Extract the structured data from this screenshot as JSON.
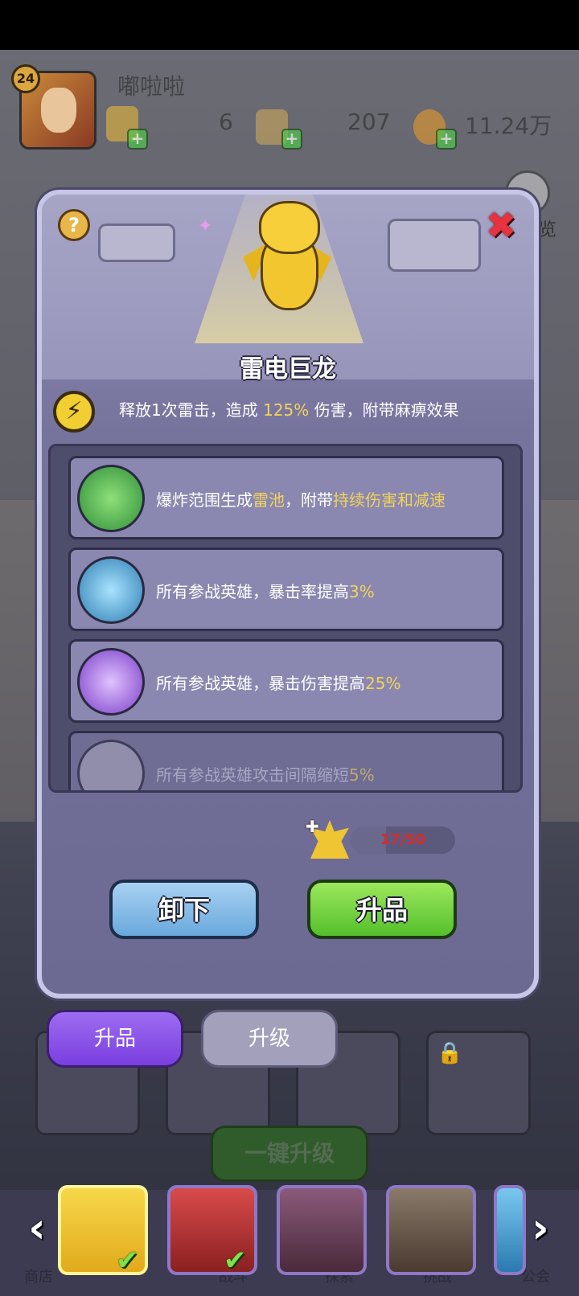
{
  "player": {
    "level": "24",
    "name": "嘟啦啦",
    "resource_1": "6",
    "resource_2": "207",
    "resource_3": "11.24万"
  },
  "side": {
    "label": "览"
  },
  "dialog": {
    "hero_name": "雷电巨龙",
    "skill": {
      "prefix": "释放1次雷击，造成",
      "value": "125%",
      "suffix": "伤害，附带麻痹效果"
    },
    "perks": [
      {
        "text": "爆炸范围生成",
        "hl1": "雷池",
        "mid": "，附带",
        "hl2": "持续伤害和减速",
        "color": "#3da84a",
        "locked": false
      },
      {
        "text": "所有参战英雄，暴击率提高",
        "hl1": "3%",
        "mid": "",
        "hl2": "",
        "color": "#3f9bd0",
        "locked": false
      },
      {
        "text": "所有参战英雄，暴击伤害提高",
        "hl1": "25%",
        "mid": "",
        "hl2": "",
        "color": "#a062e0",
        "locked": false
      },
      {
        "text": "所有参战英雄攻击间隔缩短",
        "hl1": "5%",
        "mid": "",
        "hl2": "",
        "color": "#9f9db6",
        "locked": true
      }
    ],
    "progress": {
      "current": 17,
      "max": 50,
      "label": "17/50"
    },
    "unequip_label": "卸下",
    "upgrade_rank_label": "升品"
  },
  "tabs": {
    "active": "升品",
    "inactive": "升级"
  },
  "one_key_label": "一键升级",
  "nav": {
    "shop": "商店",
    "battle": "战斗",
    "explore": "探索",
    "challenge": "挑战",
    "guild": "公会"
  },
  "colors": {
    "accent_purple": "#7a3fe0",
    "green_button": "#55bf2c",
    "blue_button": "#6aa9dc",
    "highlight_text": "#f3d25a",
    "progress_text": "#d32e2e"
  },
  "icons": {
    "help": "question-mark-icon",
    "close": "close-x-icon",
    "skill": "lightning-icon",
    "left": "chevron-left-icon",
    "right": "chevron-right-icon"
  }
}
